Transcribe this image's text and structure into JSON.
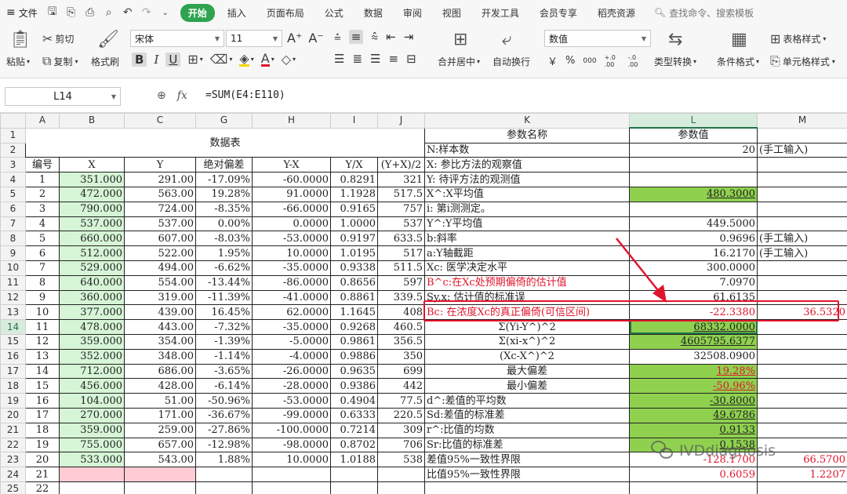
{
  "menubar": {
    "file_label": "文件",
    "tabs": [
      "开始",
      "插入",
      "页面布局",
      "公式",
      "数据",
      "审阅",
      "视图",
      "开发工具",
      "会员专享",
      "稻壳资源"
    ],
    "active_tab": "开始",
    "search_placeholder": "查找命令、搜索模板"
  },
  "ribbon": {
    "paste": "粘贴",
    "cut": "剪切",
    "copy": "复制",
    "format_painter": "格式刷",
    "font_name": "宋体",
    "font_size": "11",
    "merge_center": "合并居中",
    "wrap_text": "自动换行",
    "number_format": "数值",
    "type_convert": "类型转换",
    "conditional_format": "条件格式",
    "table_style": "表格样式",
    "cell_style": "单元格样式",
    "bold": "B",
    "italic": "I",
    "underline": "U",
    "currency": "￥",
    "percent": "%",
    "thousands": "000",
    "inc_decimal": "+.0 .00",
    "dec_decimal": "-.0 .00"
  },
  "formula_bar": {
    "cell_ref": "L14",
    "formula": "=SUM(E4:E110)"
  },
  "columns": [
    "A",
    "B",
    "C",
    "G",
    "H",
    "I",
    "J",
    "K",
    "L",
    "M"
  ],
  "selected_column": "L",
  "selected_row": "14",
  "sheet": {
    "data_table_title": "数据表",
    "headers": [
      "编号",
      "X",
      "Y",
      "绝对偏差",
      "Y-X",
      "Y/X",
      "(Y+X)/2"
    ],
    "param_name_header": "参数名称",
    "param_value_header": "参数值",
    "rows": [
      {
        "n": "1",
        "x": "351.000",
        "y": "291.00",
        "g": "-17.09%",
        "h": "-60.0000",
        "i": "0.8291",
        "j": "321"
      },
      {
        "n": "2",
        "x": "472.000",
        "y": "563.00",
        "g": "19.28%",
        "h": "91.0000",
        "i": "1.1928",
        "j": "517.5"
      },
      {
        "n": "3",
        "x": "790.000",
        "y": "724.00",
        "g": "-8.35%",
        "h": "-66.0000",
        "i": "0.9165",
        "j": "757"
      },
      {
        "n": "4",
        "x": "537.000",
        "y": "537.00",
        "g": "0.00%",
        "h": "0.0000",
        "i": "1.0000",
        "j": "537"
      },
      {
        "n": "5",
        "x": "660.000",
        "y": "607.00",
        "g": "-8.03%",
        "h": "-53.0000",
        "i": "0.9197",
        "j": "633.5"
      },
      {
        "n": "6",
        "x": "512.000",
        "y": "522.00",
        "g": "1.95%",
        "h": "10.0000",
        "i": "1.0195",
        "j": "517"
      },
      {
        "n": "7",
        "x": "529.000",
        "y": "494.00",
        "g": "-6.62%",
        "h": "-35.0000",
        "i": "0.9338",
        "j": "511.5"
      },
      {
        "n": "8",
        "x": "640.000",
        "y": "554.00",
        "g": "-13.44%",
        "h": "-86.0000",
        "i": "0.8656",
        "j": "597"
      },
      {
        "n": "9",
        "x": "360.000",
        "y": "319.00",
        "g": "-11.39%",
        "h": "-41.0000",
        "i": "0.8861",
        "j": "339.5"
      },
      {
        "n": "10",
        "x": "377.000",
        "y": "439.00",
        "g": "16.45%",
        "h": "62.0000",
        "i": "1.1645",
        "j": "408"
      },
      {
        "n": "11",
        "x": "478.000",
        "y": "443.00",
        "g": "-7.32%",
        "h": "-35.0000",
        "i": "0.9268",
        "j": "460.5"
      },
      {
        "n": "12",
        "x": "359.000",
        "y": "354.00",
        "g": "-1.39%",
        "h": "-5.0000",
        "i": "0.9861",
        "j": "356.5"
      },
      {
        "n": "13",
        "x": "352.000",
        "y": "348.00",
        "g": "-1.14%",
        "h": "-4.0000",
        "i": "0.9886",
        "j": "350"
      },
      {
        "n": "14",
        "x": "712.000",
        "y": "686.00",
        "g": "-3.65%",
        "h": "-26.0000",
        "i": "0.9635",
        "j": "699"
      },
      {
        "n": "15",
        "x": "456.000",
        "y": "428.00",
        "g": "-6.14%",
        "h": "-28.0000",
        "i": "0.9386",
        "j": "442"
      },
      {
        "n": "16",
        "x": "104.000",
        "y": "51.00",
        "g": "-50.96%",
        "h": "-53.0000",
        "i": "0.4904",
        "j": "77.5"
      },
      {
        "n": "17",
        "x": "270.000",
        "y": "171.00",
        "g": "-36.67%",
        "h": "-99.0000",
        "i": "0.6333",
        "j": "220.5"
      },
      {
        "n": "18",
        "x": "359.000",
        "y": "259.00",
        "g": "-27.86%",
        "h": "-100.0000",
        "i": "0.7214",
        "j": "309"
      },
      {
        "n": "19",
        "x": "755.000",
        "y": "657.00",
        "g": "-12.98%",
        "h": "-98.0000",
        "i": "0.8702",
        "j": "706"
      },
      {
        "n": "20",
        "x": "533.000",
        "y": "543.00",
        "g": "1.88%",
        "h": "10.0000",
        "i": "1.0188",
        "j": "538"
      },
      {
        "n": "21",
        "x": "",
        "y": "",
        "g": "",
        "h": "",
        "i": "",
        "j": ""
      },
      {
        "n": "22",
        "x": "",
        "y": "",
        "g": "",
        "h": "",
        "i": "",
        "j": ""
      }
    ],
    "params": [
      {
        "k": "N:样本数",
        "l": "20",
        "m": "(手工输入)"
      },
      {
        "k": "X: 参比方法的观察值",
        "l": "",
        "m": ""
      },
      {
        "k": "Y: 待评方法的观测值",
        "l": "",
        "m": ""
      },
      {
        "k": "X^:X平均值",
        "l": "480.3000",
        "m": ""
      },
      {
        "k": "i: 第i测测定。",
        "l": "",
        "m": ""
      },
      {
        "k": "Y^:Y平均值",
        "l": "449.5000",
        "m": ""
      },
      {
        "k": "b:斜率",
        "l": "0.9696",
        "m": "(手工输入)"
      },
      {
        "k": "a:Y轴截距",
        "l": "16.2170",
        "m": "(手工输入)"
      },
      {
        "k": "Xc: 医学决定水平",
        "l": "300.0000",
        "m": ""
      },
      {
        "k": "B^c:在Xc处预期偏倚的估计值",
        "l": "7.0970",
        "m": ""
      },
      {
        "k": "Sy.x: 估计值的标准误",
        "l": "61.6135",
        "m": ""
      },
      {
        "k": "Bc: 在浓度Xc的真正偏倚(可信区间)",
        "l": "-22.3380",
        "m": "36.5320"
      },
      {
        "k": "Σ(Yi-Y^)^2",
        "l": "68332.0000",
        "m": ""
      },
      {
        "k": "Σ(xi-x^)^2",
        "l": "4605795.6377",
        "m": ""
      },
      {
        "k": "(Xc-X^)^2",
        "l": "32508.0900",
        "m": ""
      },
      {
        "k": "最大偏差",
        "l": "19.28%",
        "m": ""
      },
      {
        "k": "最小偏差",
        "l": "-50.96%",
        "m": ""
      },
      {
        "k": "d^:差值的平均数",
        "l": "-30.8000",
        "m": ""
      },
      {
        "k": "Sd:差值的标准差",
        "l": "49.6786",
        "m": ""
      },
      {
        "k": "r^:比值的均数",
        "l": "0.9133",
        "m": ""
      },
      {
        "k": "Sr:比值的标准差",
        "l": "0.1538",
        "m": ""
      },
      {
        "k": "差值95%一致性界限",
        "l": "-128.1700",
        "m": "66.5700"
      },
      {
        "k": "比值95%一致性界限",
        "l": "0.6059",
        "m": "1.2207"
      }
    ]
  },
  "watermark": "IVDdiagnosis",
  "colors": {
    "accent_green": "#2fa34f",
    "cell_light_green": "#d6f5d6",
    "cell_green": "#8fd14f",
    "cell_pink": "#ffccd4",
    "highlight_red": "#e0152b"
  }
}
